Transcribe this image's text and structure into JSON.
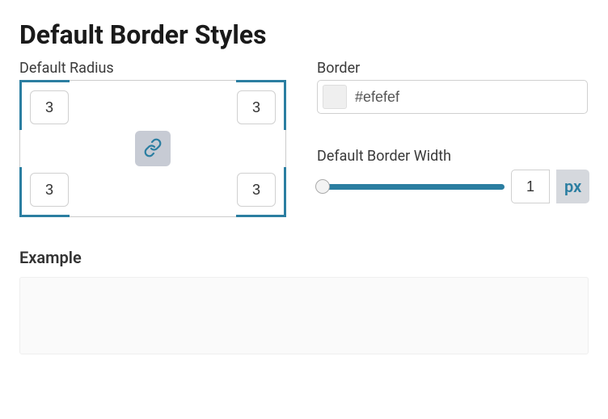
{
  "page": {
    "title": "Default Border Styles"
  },
  "radius": {
    "label": "Default Radius",
    "tl": "3",
    "tr": "3",
    "bl": "3",
    "br": "3"
  },
  "border_color": {
    "label": "Border",
    "value": "#efefef"
  },
  "border_width": {
    "label": "Default Border Width",
    "value": "1",
    "unit": "px"
  },
  "example": {
    "title": "Example"
  }
}
